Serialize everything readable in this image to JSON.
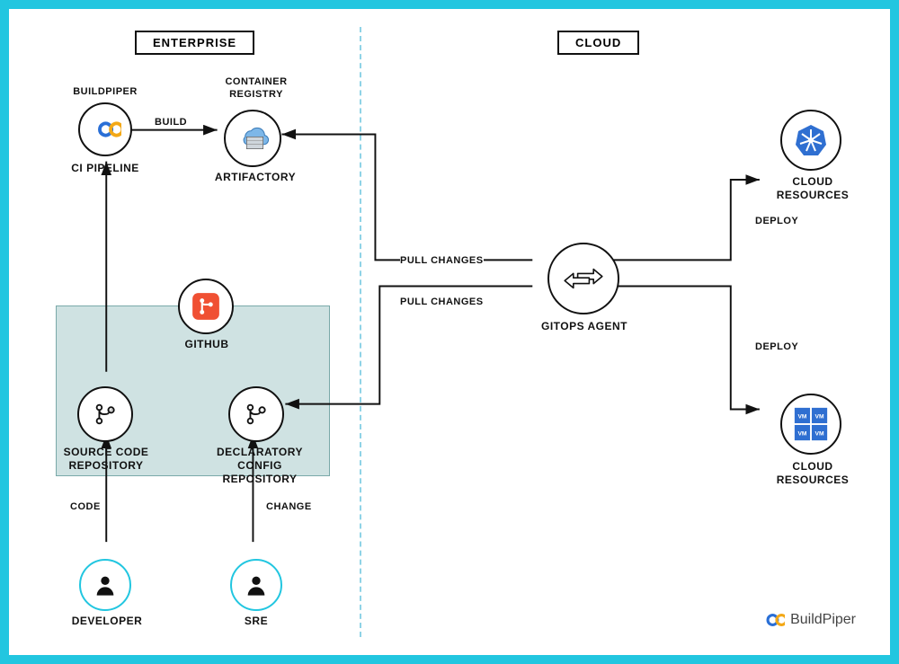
{
  "zones": {
    "enterprise": "ENTERPRISE",
    "cloud": "CLOUD"
  },
  "nodes": {
    "buildpiper_top": "BUILDPIPER",
    "ci_pipeline": "CI PIPELINE",
    "container_registry_top": "CONTAINER\nREGISTRY",
    "artifactory": "ARTIFACTORY",
    "github": "GITHUB",
    "source_repo": "SOURCE CODE\nREPOSITORY",
    "config_repo": "DECLARATORY\nCONFIG REPOSITORY",
    "developer": "DEVELOPER",
    "sre": "SRE",
    "gitops_agent": "GITOPS AGENT",
    "cloud_resources_1": "CLOUD\nRESOURCES",
    "cloud_resources_2": "CLOUD\nRESOURCES"
  },
  "edges": {
    "build": "BUILD",
    "pull_changes_1": "PULL CHANGES",
    "pull_changes_2": "PULL CHANGES",
    "deploy_1": "DEPLOY",
    "deploy_2": "DEPLOY",
    "code": "CODE",
    "change": "CHANGE"
  },
  "brand": "BuildPiper",
  "vm_label": "VM"
}
